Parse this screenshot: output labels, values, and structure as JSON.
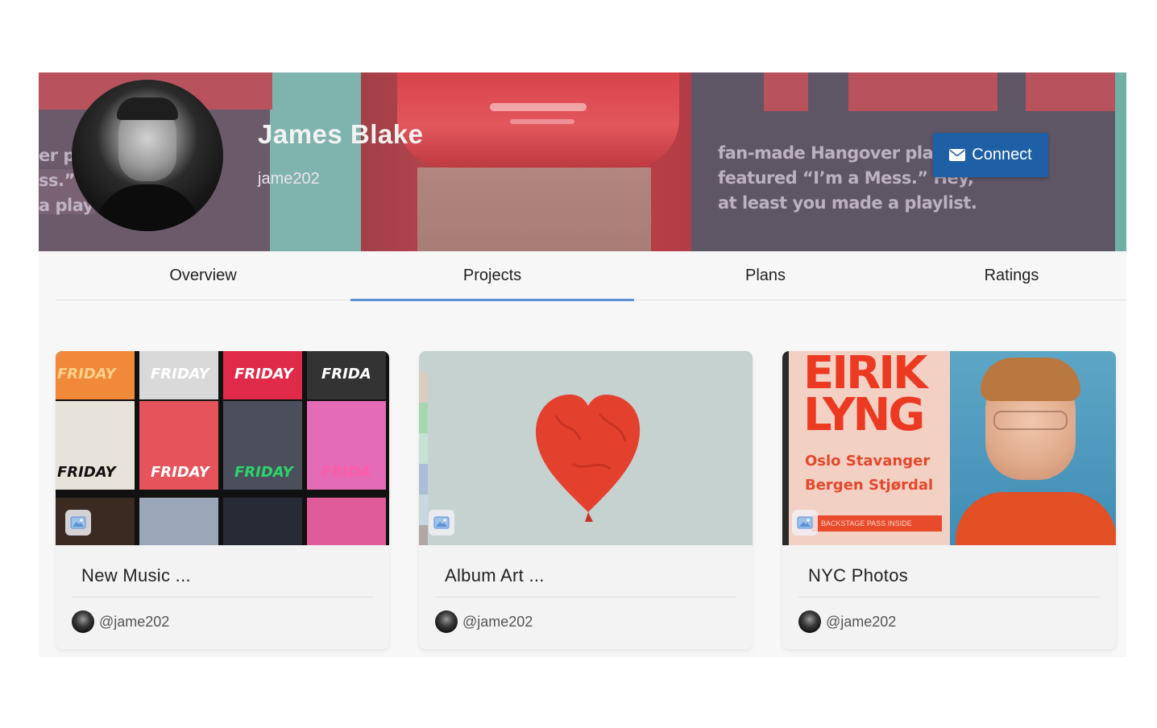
{
  "profile": {
    "name": "James Blake",
    "username": "jame202",
    "connect_label": "Connect",
    "banner_text_right": [
      "fan-made Hangover play",
      "featured “I’m a Mess.” Hey,",
      "at least you made a playlist."
    ],
    "banner_text_left": [
      "er p",
      "ss.”",
      "a play"
    ]
  },
  "tabs": [
    {
      "label": "Overview",
      "active": false
    },
    {
      "label": "Projects",
      "active": true
    },
    {
      "label": "Plans",
      "active": false
    },
    {
      "label": "Ratings",
      "active": false
    }
  ],
  "projects": [
    {
      "title": "New Music ...",
      "user": "@jame202",
      "thumb_text": [
        "FRIDAY",
        "FRIDAY",
        "FRIDAY",
        "FRIDA",
        "FRIDAY",
        "FRIDAY",
        "FRIDAY",
        "FRIDA"
      ]
    },
    {
      "title": "Album Art ...",
      "user": "@jame202"
    },
    {
      "title": "NYC Photos",
      "user": "@jame202",
      "thumb_text": {
        "artist": "EIRIK LYNG",
        "cities_line1": "Oslo Stavanger",
        "cities_line2": "Bergen Stjørdal",
        "pass": "BACKSTAGE PASS INSIDE"
      }
    }
  ],
  "colors": {
    "accent": "#5b8fd6",
    "connect_button": "#1f5fa6"
  },
  "icons": {
    "connect": "envelope-icon",
    "thumb_badge": "image-icon"
  }
}
